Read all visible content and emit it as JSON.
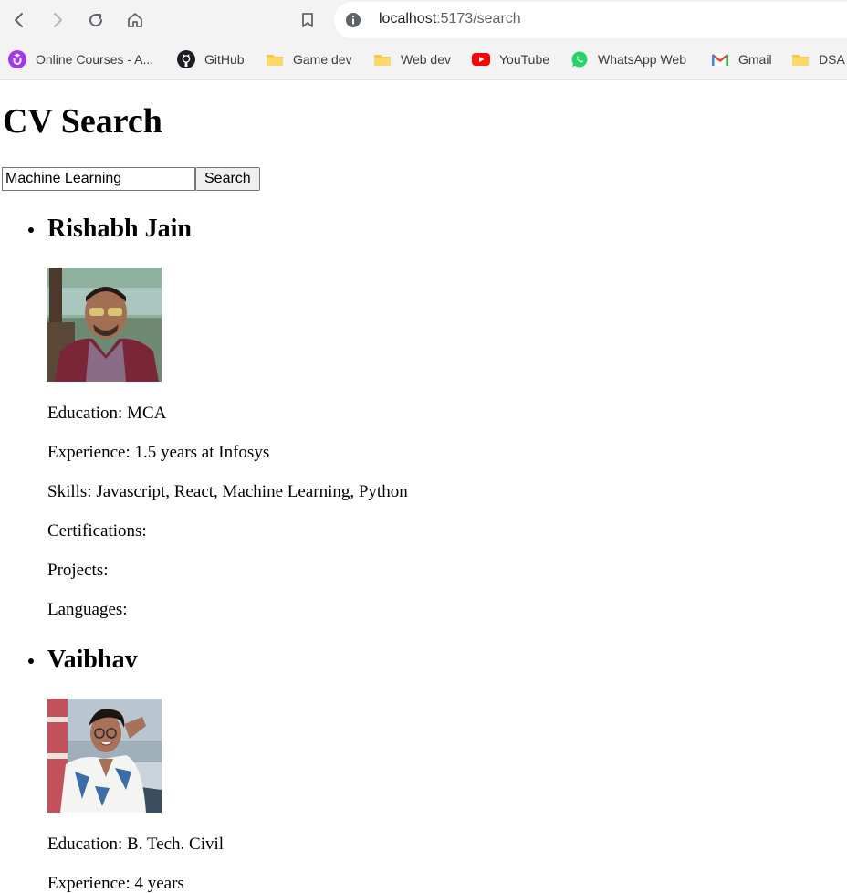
{
  "browser": {
    "url_host": "localhost",
    "url_path": ":5173/search",
    "bookmarks": [
      {
        "label": "Online Courses - A...",
        "icon": "udemy-icon"
      },
      {
        "label": "GitHub",
        "icon": "github-icon"
      },
      {
        "label": "Game dev",
        "icon": "folder-icon"
      },
      {
        "label": "Web dev",
        "icon": "folder-icon"
      },
      {
        "label": "YouTube",
        "icon": "youtube-icon"
      },
      {
        "label": "WhatsApp Web",
        "icon": "whatsapp-icon"
      },
      {
        "label": "Gmail",
        "icon": "gmail-icon"
      },
      {
        "label": "DSA",
        "icon": "folder-icon"
      }
    ]
  },
  "page": {
    "title": "CV Search",
    "search_value": "Machine Learning",
    "search_button": "Search"
  },
  "results": [
    {
      "name": "Rishabh Jain",
      "education": "Education: MCA",
      "experience": "Experience: 1.5 years at Infosys",
      "skills": "Skills: Javascript, React, Machine Learning, Python",
      "certifications": "Certifications:",
      "projects": "Projects:",
      "languages": "Languages:"
    },
    {
      "name": "Vaibhav",
      "education": "Education: B. Tech. Civil",
      "experience": "Experience: 4 years"
    }
  ]
}
